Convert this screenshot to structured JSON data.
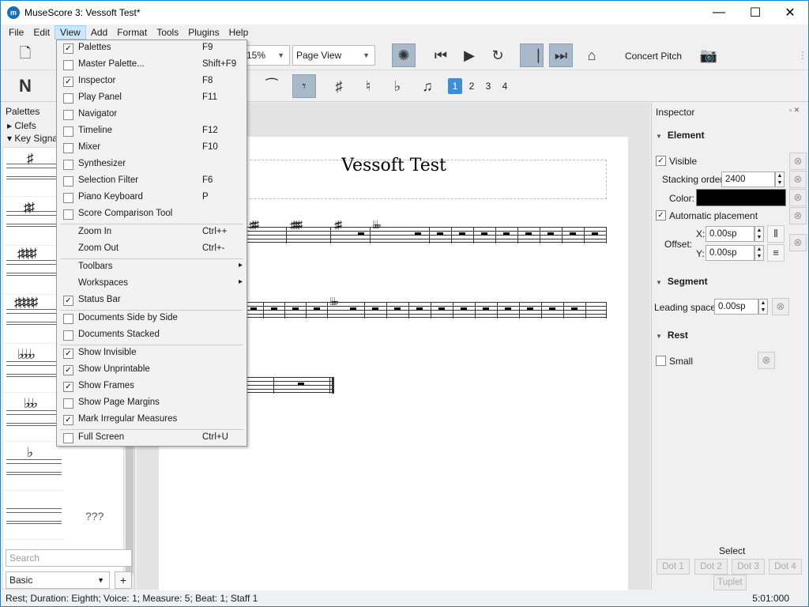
{
  "window": {
    "title": "MuseScore 3: Vessoft Test*",
    "app_icon": "musescore-logo-icon"
  },
  "menubar": [
    "File",
    "Edit",
    "View",
    "Add",
    "Format",
    "Tools",
    "Plugins",
    "Help"
  ],
  "toolbar": {
    "zoom": "15%",
    "view_mode": "Page View",
    "concert_pitch": "Concert Pitch"
  },
  "voices": [
    "1",
    "2",
    "3",
    "4"
  ],
  "palette": {
    "title": "Palettes",
    "clefs": "Clefs",
    "key_sig": "Key Signat",
    "unknown": "???",
    "search_placeholder": "Search",
    "workspace": "Basic",
    "add": "+"
  },
  "score": {
    "title": "Vessoft Test"
  },
  "view_menu": [
    {
      "label": "Palettes",
      "shortcut": "F9",
      "checked": true
    },
    {
      "label": "Master Palette...",
      "shortcut": "Shift+F9",
      "checked": false
    },
    {
      "label": "Inspector",
      "shortcut": "F8",
      "checked": true
    },
    {
      "label": "Play Panel",
      "shortcut": "F11",
      "checked": false
    },
    {
      "label": "Navigator",
      "shortcut": "",
      "checked": false
    },
    {
      "label": "Timeline",
      "shortcut": "F12",
      "checked": false
    },
    {
      "label": "Mixer",
      "shortcut": "F10",
      "checked": false
    },
    {
      "label": "Synthesizer",
      "shortcut": "",
      "checked": false
    },
    {
      "label": "Selection Filter",
      "shortcut": "F6",
      "checked": false
    },
    {
      "label": "Piano Keyboard",
      "shortcut": "P",
      "checked": false
    },
    {
      "label": "Score Comparison Tool",
      "shortcut": "",
      "checked": false
    },
    {
      "label": "Zoom In",
      "shortcut": "Ctrl++"
    },
    {
      "label": "Zoom Out",
      "shortcut": "Ctrl+-"
    },
    {
      "label": "Toolbars",
      "submenu": true
    },
    {
      "label": "Workspaces",
      "submenu": true
    },
    {
      "label": "Status Bar",
      "checked": true
    },
    {
      "label": "Documents Side by Side",
      "checked": false
    },
    {
      "label": "Documents Stacked",
      "checked": false
    },
    {
      "label": "Show Invisible",
      "checked": true
    },
    {
      "label": "Show Unprintable",
      "checked": true
    },
    {
      "label": "Show Frames",
      "checked": true
    },
    {
      "label": "Show Page Margins",
      "checked": false
    },
    {
      "label": "Mark Irregular Measures",
      "checked": true
    },
    {
      "label": "Full Screen",
      "shortcut": "Ctrl+U",
      "checked": false
    }
  ],
  "inspector": {
    "title": "Inspector",
    "element": "Element",
    "visible": "Visible",
    "stacking_label": "Stacking order:",
    "stacking_value": "2400",
    "color_label": "Color:",
    "color_value": "#000000",
    "auto_place": "Automatic placement",
    "offset_label": "Offset:",
    "x_label": "X:",
    "x_value": "0.00sp",
    "y_label": "Y:",
    "y_value": "0.00sp",
    "segment": "Segment",
    "leading_label": "Leading space:",
    "leading_value": "0.00sp",
    "rest": "Rest",
    "small": "Small",
    "select": "Select",
    "dot1": "Dot 1",
    "dot2": "Dot 2",
    "dot3": "Dot 3",
    "dot4": "Dot 4",
    "tuplet": "Tuplet"
  },
  "status": {
    "left": "Rest; Duration: Eighth; Voice: 1;  Measure: 5; Beat: 1; Staff 1",
    "right": "5:01:000"
  }
}
